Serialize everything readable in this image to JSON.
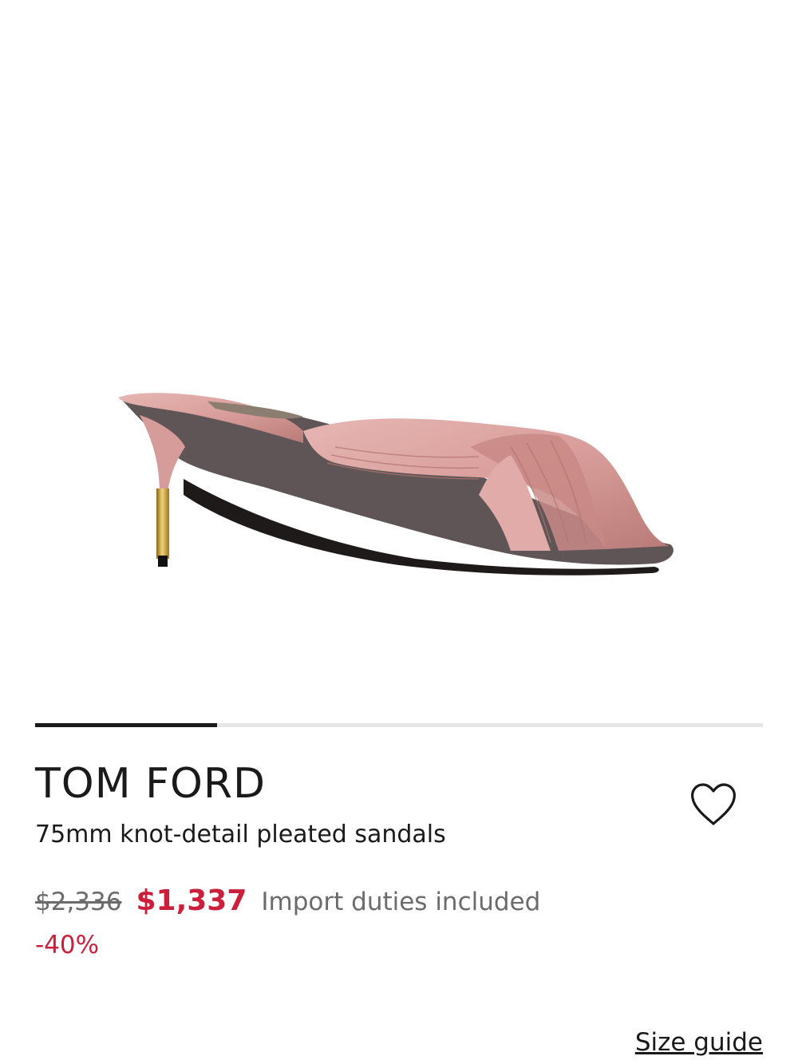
{
  "product": {
    "brand": "TOM FORD",
    "name": "75mm knot-detail pleated sandals",
    "image_alt": "pink satin knot-detail pleated sandal with gold heel",
    "wishlist_icon": "heart-outline-icon"
  },
  "gallery": {
    "progress_fraction": 0.25
  },
  "pricing": {
    "original_price": "$2,336",
    "sale_price": "$1,337",
    "duties_note": "Import duties included",
    "discount": "-40%"
  },
  "links": {
    "size_guide": "Size guide"
  },
  "colors": {
    "sale_red": "#cc1f3b",
    "muted_grey": "#6b6b6b",
    "progress_active": "#1a1a1a",
    "progress_track": "#e6e6e6"
  }
}
